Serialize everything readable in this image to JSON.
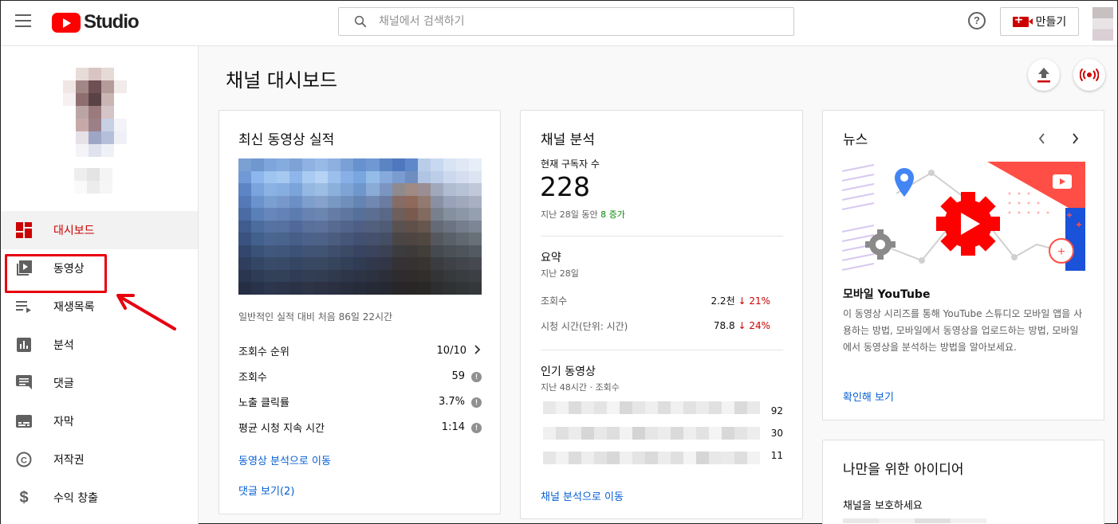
{
  "header": {
    "logo_text": "Studio",
    "search_placeholder": "채널에서 검색하기",
    "help_label": "?",
    "create_label": "만들기"
  },
  "sidebar": {
    "items": [
      {
        "label": "대시보드",
        "icon": "dashboard-icon",
        "active": true
      },
      {
        "label": "동영상",
        "icon": "video-library-icon",
        "active": false
      },
      {
        "label": "재생목록",
        "icon": "playlist-icon",
        "active": false
      },
      {
        "label": "분석",
        "icon": "analytics-icon",
        "active": false
      },
      {
        "label": "댓글",
        "icon": "comment-icon",
        "active": false
      },
      {
        "label": "자막",
        "icon": "subtitles-icon",
        "active": false
      },
      {
        "label": "저작권",
        "icon": "copyright-icon",
        "active": false
      },
      {
        "label": "수익 창출",
        "icon": "dollar-icon",
        "active": false
      }
    ]
  },
  "main": {
    "title": "채널 대시보드",
    "upload_icon": "upload-icon",
    "live_icon": "live-broadcast-icon"
  },
  "latest_video": {
    "title": "최신 동영상 실적",
    "caption": "일반적인 실적 대비 처음 86일 22시간",
    "stats": [
      {
        "label": "조회수 순위",
        "value": "10/10",
        "trail": "chevron"
      },
      {
        "label": "조회수",
        "value": "59",
        "trail": "info"
      },
      {
        "label": "노출 클릭률",
        "value": "3.7%",
        "trail": "info"
      },
      {
        "label": "평균 시청 지속 시간",
        "value": "1:14",
        "trail": "info"
      }
    ],
    "link_analytics": "동영상 분석으로 이동",
    "link_comments": "댓글 보기(2)"
  },
  "channel_analytics": {
    "title": "채널 분석",
    "subs_label": "현재 구독자 수",
    "subs_count": "228",
    "subs_period": "지난 28일 동안",
    "subs_change": "8 증가",
    "summary_title": "요약",
    "summary_period": "지난 28일",
    "summary_rows": [
      {
        "label": "조회수",
        "value": "2.2천",
        "change": "21%"
      },
      {
        "label": "시청 시간(단위: 시간)",
        "value": "78.8",
        "change": "24%"
      }
    ],
    "top_title": "인기 동영상",
    "top_period": "지난 48시간 · 조회수",
    "top_values": [
      "92",
      "30",
      "11"
    ],
    "link": "채널 분석으로 이동"
  },
  "news": {
    "title": "뉴스",
    "headline": "모바일 YouTube",
    "body": "이 동영상 시리즈를 통해 YouTube 스튜디오 모바일 앱을 사용하는 방법, 모바일에서 동영상을 업로드하는 방법, 모바일에서 동영상을 분석하는 방법을 알아보세요.",
    "link": "확인해 보기"
  },
  "ideas": {
    "title": "나만을 위한 아이디어",
    "item": "채널을 보호하세요"
  },
  "colors": {
    "brand_red": "#ff0000",
    "active_red": "#cc0000",
    "link_blue": "#065fd4",
    "increase_green": "#0a8a0a",
    "annotation_red": "#e8000e"
  }
}
